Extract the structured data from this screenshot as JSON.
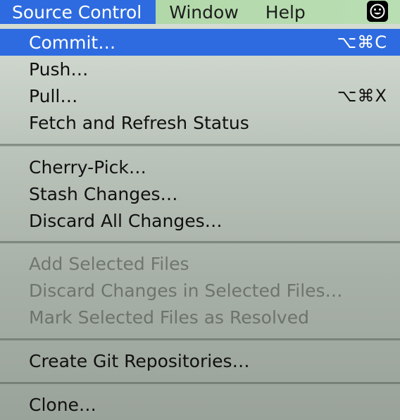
{
  "menubar": {
    "items": [
      {
        "label": "Source Control",
        "active": true
      },
      {
        "label": "Window"
      },
      {
        "label": "Help"
      }
    ],
    "status_icon": "emoji-smile-icon"
  },
  "menu": {
    "items": [
      {
        "label": "Commit…",
        "shortcut": "⌥⌘C",
        "state": "highlighted"
      },
      {
        "label": "Push…",
        "shortcut": ""
      },
      {
        "label": "Pull…",
        "shortcut": "⌥⌘X"
      },
      {
        "label": "Fetch and Refresh Status",
        "shortcut": ""
      },
      {
        "label": "Cherry-Pick…",
        "shortcut": ""
      },
      {
        "label": "Stash Changes…",
        "shortcut": ""
      },
      {
        "label": "Discard All Changes…",
        "shortcut": ""
      },
      {
        "label": "Add Selected Files",
        "shortcut": "",
        "state": "disabled"
      },
      {
        "label": "Discard Changes in Selected Files…",
        "shortcut": "",
        "state": "disabled"
      },
      {
        "label": "Mark Selected Files as Resolved",
        "shortcut": "",
        "state": "disabled"
      },
      {
        "label": "Create Git Repositories…",
        "shortcut": ""
      },
      {
        "label": "Clone…",
        "shortcut": ""
      }
    ]
  },
  "colors": {
    "highlight": "#2e6be0",
    "menubar": "#b6daae"
  }
}
